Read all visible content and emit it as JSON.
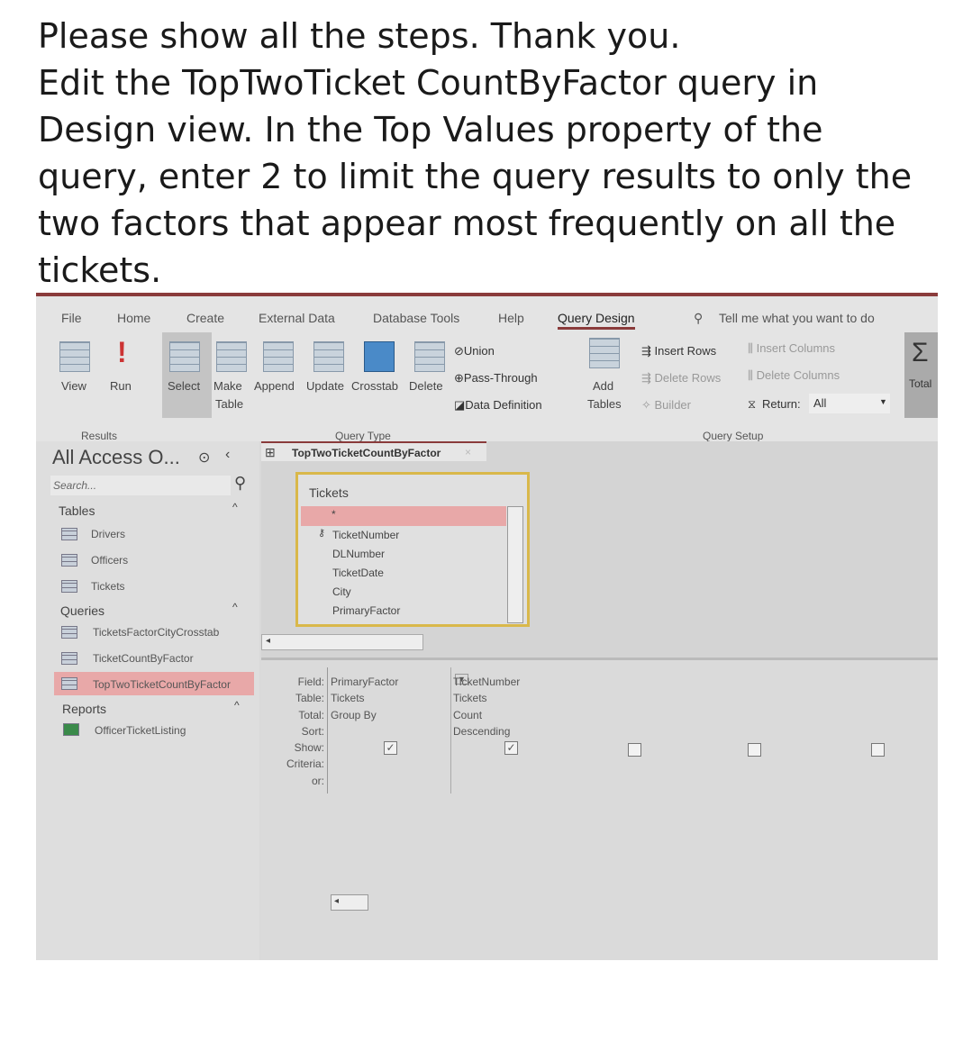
{
  "question": [
    "Please show all the steps. Thank you.",
    "Edit the TopTwoTicket CountByFactor query in",
    "Design view. In the Top Values property of the",
    "query, enter 2 to limit the query results to only the",
    "two factors that appear most frequently on all the",
    "tickets."
  ],
  "ribbon": {
    "tabs": [
      "File",
      "Home",
      "Create",
      "External Data",
      "Database Tools",
      "Help",
      "Query Design"
    ],
    "tell_me": "Tell me what you want to do",
    "results": {
      "view": "View",
      "run": "Run",
      "group": "Results"
    },
    "query_type": {
      "select": "Select",
      "make_table": "Make",
      "make_table2": "Table",
      "append": "Append",
      "update": "Update",
      "crosstab": "Crosstab",
      "delete": "Delete",
      "union": "Union",
      "pass_through": "Pass-Through",
      "data_definition": "Data Definition",
      "group": "Query Type"
    },
    "query_setup": {
      "add_tables": "Add",
      "add_tables2": "Tables",
      "insert_rows": "Insert Rows",
      "delete_rows": "Delete Rows",
      "builder": "Builder",
      "insert_columns": "Insert Columns",
      "delete_columns": "Delete Columns",
      "return_label": "Return:",
      "return_value": "All",
      "group": "Query Setup"
    },
    "totals": "Total"
  },
  "nav": {
    "title": "All Access O...",
    "search_placeholder": "Search...",
    "sections": [
      {
        "label": "Tables",
        "items": [
          "Drivers",
          "Officers",
          "Tickets"
        ]
      },
      {
        "label": "Queries",
        "items": [
          "TicketsFactorCityCrosstab",
          "TicketCountByFactor",
          "TopTwoTicketCountByFactor"
        ]
      },
      {
        "label": "Reports",
        "items": [
          "OfficerTicketListing"
        ]
      }
    ]
  },
  "document": {
    "tab": "TopTwoTicketCountByFactor",
    "table": {
      "name": "Tickets",
      "fields": [
        "*",
        "TicketNumber",
        "DLNumber",
        "TicketDate",
        "City",
        "PrimaryFactor"
      ]
    },
    "grid": {
      "row_labels": [
        "Field:",
        "Table:",
        "Total:",
        "Sort:",
        "Show:",
        "Criteria:",
        "or:"
      ],
      "columns": [
        {
          "field": "PrimaryFactor",
          "table": "Tickets",
          "total": "Group By",
          "sort": "",
          "show": true
        },
        {
          "field": "TicketNumber",
          "table": "Tickets",
          "total": "Count",
          "sort": "Descending",
          "show": true
        }
      ]
    }
  },
  "colors": {
    "active_tab_underline": "#8a3b3b",
    "selected_nav": "#e8a8a8",
    "table_border": "#d9b84a"
  }
}
